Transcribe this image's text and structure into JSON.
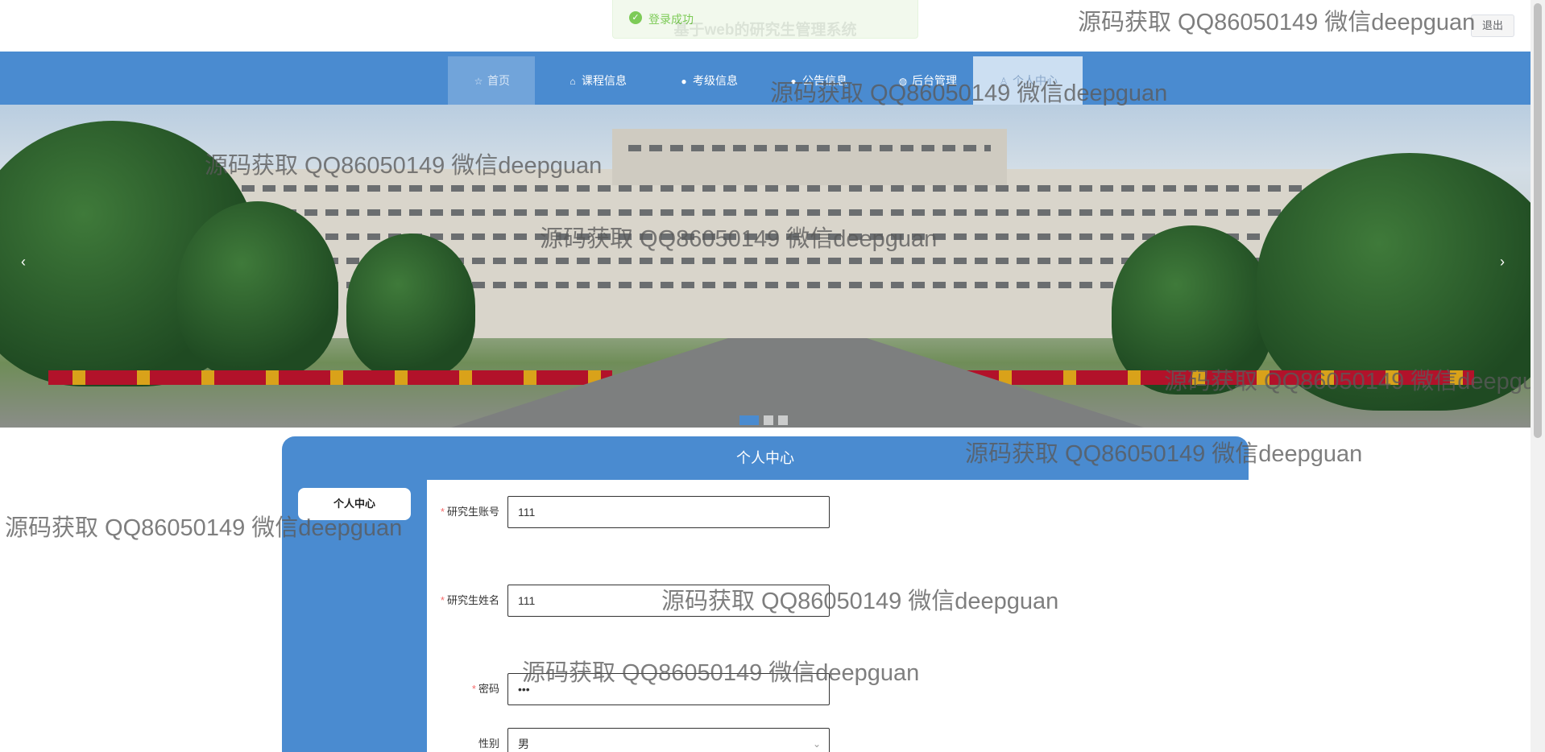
{
  "header": {
    "site_title": "基于web的研究生管理系统",
    "toast_text": "登录成功",
    "logout_label": "退出"
  },
  "nav": {
    "items": [
      {
        "label": "首页",
        "icon": "star-icon"
      },
      {
        "label": "课程信息",
        "icon": "home-icon"
      },
      {
        "label": "考级信息",
        "icon": "info-icon"
      },
      {
        "label": "公告信息",
        "icon": "bell-icon"
      },
      {
        "label": "后台管理",
        "icon": "globe-icon"
      },
      {
        "label": "个人中心",
        "icon": "user-icon"
      }
    ]
  },
  "banner": {
    "prev_arrow": "‹",
    "next_arrow": "›",
    "slide_count": 3,
    "active_slide": 1
  },
  "panel": {
    "title": "个人中心",
    "side_menu": [
      "个人中心"
    ]
  },
  "form": {
    "fields": [
      {
        "label": "研究生账号",
        "value": "111",
        "required": true
      },
      {
        "label": "研究生姓名",
        "value": "111",
        "required": true
      },
      {
        "label": "密码",
        "value": "•••",
        "required": true
      },
      {
        "label": "性别",
        "value": "男",
        "required": false
      }
    ]
  },
  "watermark": "源码获取 QQ86050149 微信deepguan",
  "colors": {
    "nav_bg": "#4a8bd0",
    "required": "#f56c6c",
    "toast": "#67c23a"
  }
}
